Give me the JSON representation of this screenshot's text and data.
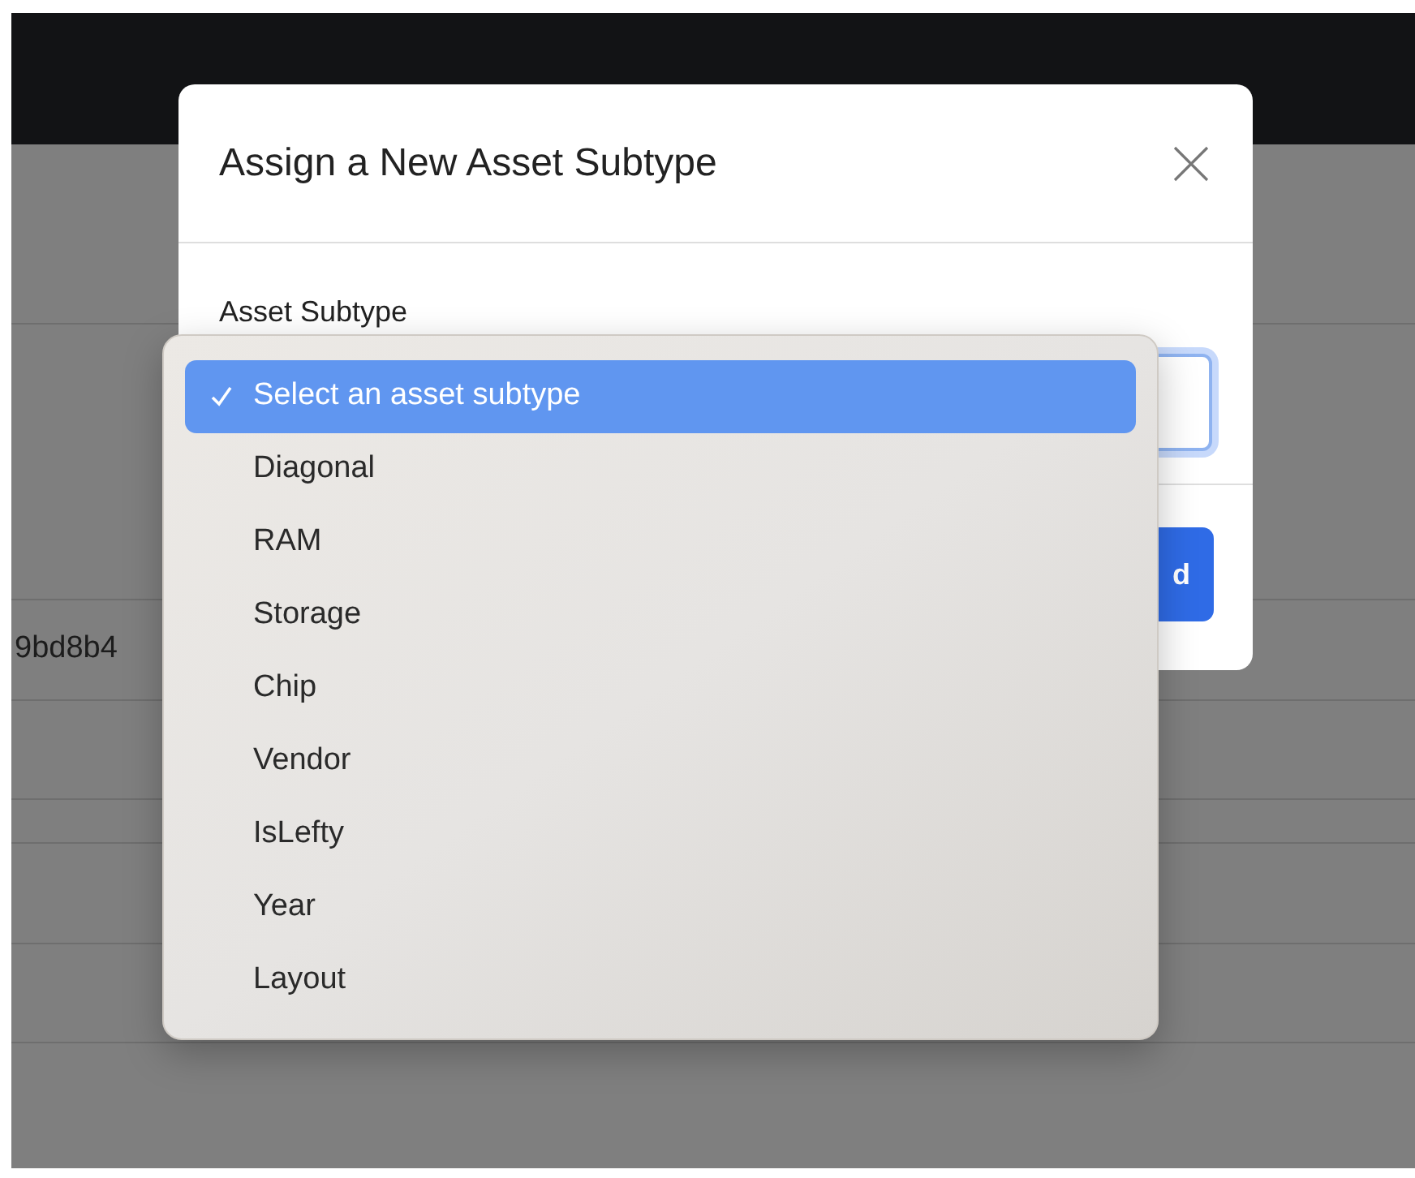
{
  "background": {
    "table": {
      "rows": [
        {
          "cells": []
        },
        {
          "cells": []
        },
        {
          "cells": [
            "9bd8b4"
          ]
        },
        {
          "cells": []
        },
        {
          "cells": []
        },
        {
          "cells": []
        },
        {
          "cells": []
        }
      ]
    }
  },
  "dialog": {
    "title": "Assign a New Asset Subtype",
    "field": {
      "label": "Asset Subtype",
      "focused": true
    },
    "button": "d"
  },
  "select_menu": {
    "options": [
      {
        "label": "Select an asset subtype",
        "selected": true
      },
      {
        "label": "Diagonal",
        "selected": false
      },
      {
        "label": "RAM",
        "selected": false
      },
      {
        "label": "Storage",
        "selected": false
      },
      {
        "label": "Chip",
        "selected": false
      },
      {
        "label": "Vendor",
        "selected": false
      },
      {
        "label": "IsLefty",
        "selected": false
      },
      {
        "label": "Year",
        "selected": false
      },
      {
        "label": "Layout",
        "selected": false
      }
    ]
  }
}
